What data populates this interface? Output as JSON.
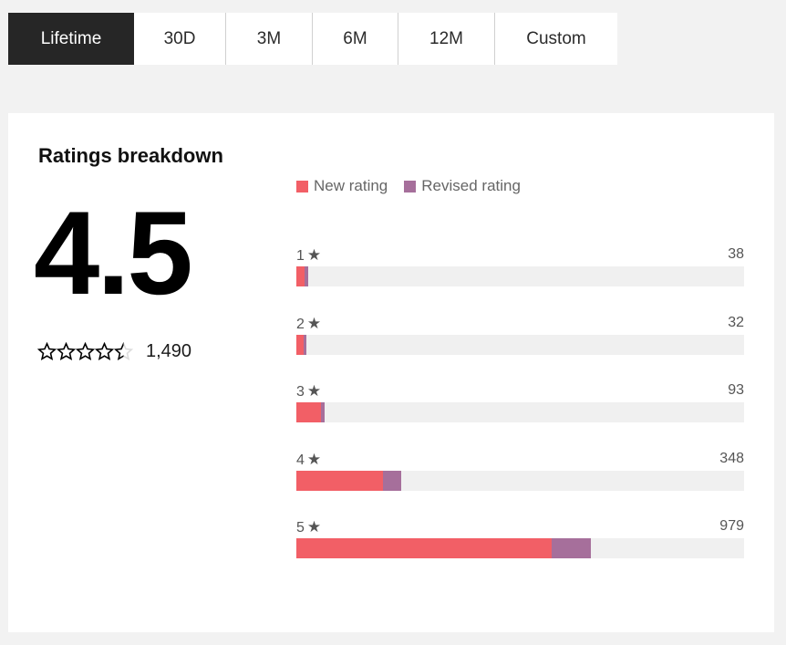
{
  "tabs": [
    {
      "label": "Lifetime",
      "active": true
    },
    {
      "label": "30D",
      "active": false
    },
    {
      "label": "3M",
      "active": false
    },
    {
      "label": "6M",
      "active": false
    },
    {
      "label": "12M",
      "active": false
    },
    {
      "label": "Custom",
      "active": false
    }
  ],
  "card": {
    "title": "Ratings breakdown",
    "average_rating": "4.5",
    "star_rating_value": 4.5,
    "star_rating_max": 5,
    "total_count": "1,490"
  },
  "colors": {
    "new_rating": "#f25f66",
    "revised_rating": "#a66f9b",
    "track": "#f0f0f0",
    "active_tab_bg": "#262626"
  },
  "chart_data": {
    "type": "bar",
    "orientation": "horizontal",
    "stacked": true,
    "title": "Ratings breakdown",
    "legend": [
      "New rating",
      "Revised rating"
    ],
    "legend_position": "top",
    "categories": [
      "1",
      "2",
      "3",
      "4",
      "5"
    ],
    "category_suffix_icon": "star-icon",
    "totals": [
      38,
      32,
      93,
      348,
      979
    ],
    "total_labels": [
      "38",
      "32",
      "93",
      "348",
      "979"
    ],
    "series": [
      {
        "name": "New rating",
        "values": [
          27,
          24,
          82,
          288,
          850
        ]
      },
      {
        "name": "Revised rating",
        "values": [
          11,
          8,
          11,
          60,
          129
        ]
      }
    ],
    "xlim": [
      0,
      1490
    ]
  }
}
